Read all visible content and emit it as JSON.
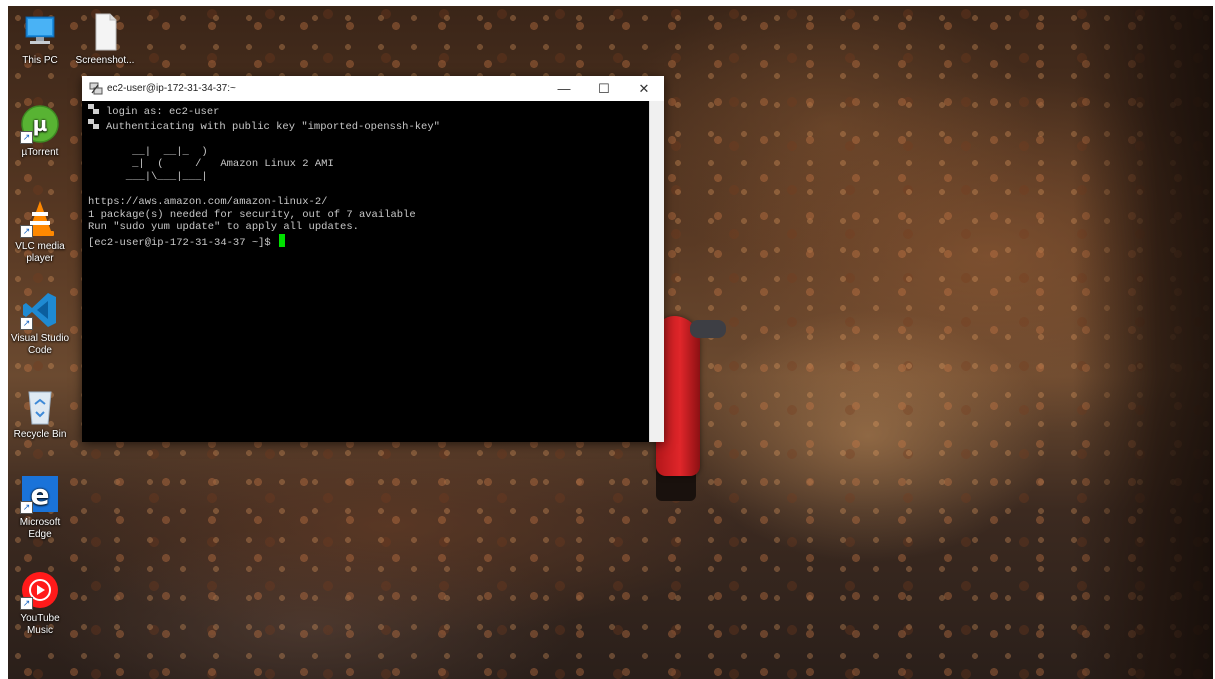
{
  "desktop_icons": [
    {
      "label": "This PC",
      "icon": "computer-icon"
    },
    {
      "label": "Screenshot...",
      "icon": "file-icon"
    },
    {
      "label": "µTorrent",
      "icon": "utorrent-icon"
    },
    {
      "label": "VLC media player",
      "icon": "vlc-icon"
    },
    {
      "label": "Visual Studio Code",
      "icon": "vscode-icon"
    },
    {
      "label": "Recycle Bin",
      "icon": "recycle-bin-icon"
    },
    {
      "label": "Microsoft Edge",
      "icon": "edge-icon"
    },
    {
      "label": "YouTube Music",
      "icon": "youtube-music-icon"
    }
  ],
  "window": {
    "title": "ec2-user@ip-172-31-34-37:~",
    "minimize": "—",
    "maximize": "☐",
    "close": "✕"
  },
  "terminal": {
    "login_line": "login as: ec2-user",
    "auth_line": "Authenticating with public key \"imported-openssh-key\"",
    "banner_1": "       __|  __|_  )",
    "banner_2": "       _|  (     /   Amazon Linux 2 AMI",
    "banner_3": "      ___|\\___|___|",
    "url_line": "https://aws.amazon.com/amazon-linux-2/",
    "security_line": "1 package(s) needed for security, out of 7 available",
    "update_line": "Run \"sudo yum update\" to apply all updates.",
    "prompt": "[ec2-user@ip-172-31-34-37 ~]$ "
  },
  "colors": {
    "terminal_bg": "#000000",
    "terminal_fg": "#c8c8c8",
    "cursor": "#00e000",
    "titlebar_bg": "#ffffff"
  }
}
